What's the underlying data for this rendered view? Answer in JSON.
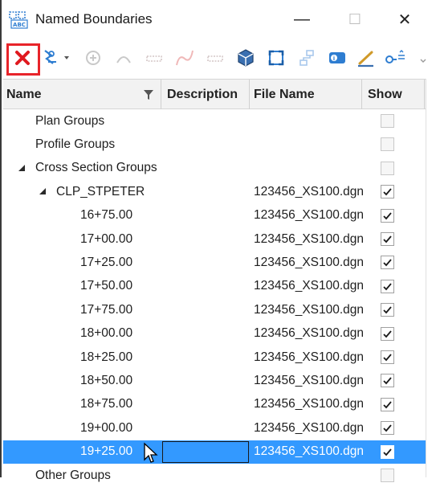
{
  "window": {
    "title": "Named Boundaries",
    "minimize_glyph": "—",
    "maximize_glyph": "☐",
    "close_glyph": "✕"
  },
  "toolbar": {
    "items": [
      {
        "name": "delete-icon",
        "enabled": true,
        "highlighted": true
      },
      {
        "name": "create-boundary-dropdown-icon",
        "enabled": true
      },
      {
        "name": "place-boundary-icon",
        "enabled": false
      },
      {
        "name": "group-icon",
        "enabled": false
      },
      {
        "name": "profile-icon",
        "enabled": false
      },
      {
        "name": "curve-icon",
        "enabled": false
      },
      {
        "name": "grid-icon",
        "enabled": false
      },
      {
        "name": "drawing-model-icon",
        "enabled": true
      },
      {
        "name": "fit-view-icon",
        "enabled": true
      },
      {
        "name": "hierarchy-icon",
        "enabled": false
      },
      {
        "name": "properties-icon",
        "enabled": true
      },
      {
        "name": "edit-icon",
        "enabled": true
      },
      {
        "name": "key-icon",
        "enabled": true
      }
    ]
  },
  "table": {
    "columns": {
      "name": "Name",
      "description": "Description",
      "file_name": "File Name",
      "show": "Show"
    },
    "rows": [
      {
        "name": "Plan Groups",
        "level": 0,
        "expander": "none",
        "file": "",
        "show": false,
        "enabled": false
      },
      {
        "name": "Profile Groups",
        "level": 0,
        "expander": "none",
        "file": "",
        "show": false,
        "enabled": false
      },
      {
        "name": "Cross Section Groups",
        "level": 0,
        "expander": "expanded",
        "file": "",
        "show": false,
        "enabled": false
      },
      {
        "name": "CLP_STPETER",
        "level": 1,
        "expander": "expanded",
        "file": "123456_XS100.dgn",
        "show": true,
        "enabled": true
      },
      {
        "name": "16+75.00",
        "level": 2,
        "expander": "none",
        "file": "123456_XS100.dgn",
        "show": true,
        "enabled": true
      },
      {
        "name": "17+00.00",
        "level": 2,
        "expander": "none",
        "file": "123456_XS100.dgn",
        "show": true,
        "enabled": true
      },
      {
        "name": "17+25.00",
        "level": 2,
        "expander": "none",
        "file": "123456_XS100.dgn",
        "show": true,
        "enabled": true
      },
      {
        "name": "17+50.00",
        "level": 2,
        "expander": "none",
        "file": "123456_XS100.dgn",
        "show": true,
        "enabled": true
      },
      {
        "name": "17+75.00",
        "level": 2,
        "expander": "none",
        "file": "123456_XS100.dgn",
        "show": true,
        "enabled": true
      },
      {
        "name": "18+00.00",
        "level": 2,
        "expander": "none",
        "file": "123456_XS100.dgn",
        "show": true,
        "enabled": true
      },
      {
        "name": "18+25.00",
        "level": 2,
        "expander": "none",
        "file": "123456_XS100.dgn",
        "show": true,
        "enabled": true
      },
      {
        "name": "18+50.00",
        "level": 2,
        "expander": "none",
        "file": "123456_XS100.dgn",
        "show": true,
        "enabled": true
      },
      {
        "name": "18+75.00",
        "level": 2,
        "expander": "none",
        "file": "123456_XS100.dgn",
        "show": true,
        "enabled": true
      },
      {
        "name": "19+00.00",
        "level": 2,
        "expander": "none",
        "file": "123456_XS100.dgn",
        "show": true,
        "enabled": true
      },
      {
        "name": "19+25.00",
        "level": 2,
        "expander": "none",
        "file": "123456_XS100.dgn",
        "show": true,
        "enabled": true,
        "selected": true
      },
      {
        "name": "Other Groups",
        "level": 0,
        "expander": "none",
        "file": "",
        "show": false,
        "enabled": false
      }
    ]
  },
  "colors": {
    "selection": "#3399ff",
    "highlight_box": "#e8242a",
    "delete_x": "#e0191f"
  }
}
